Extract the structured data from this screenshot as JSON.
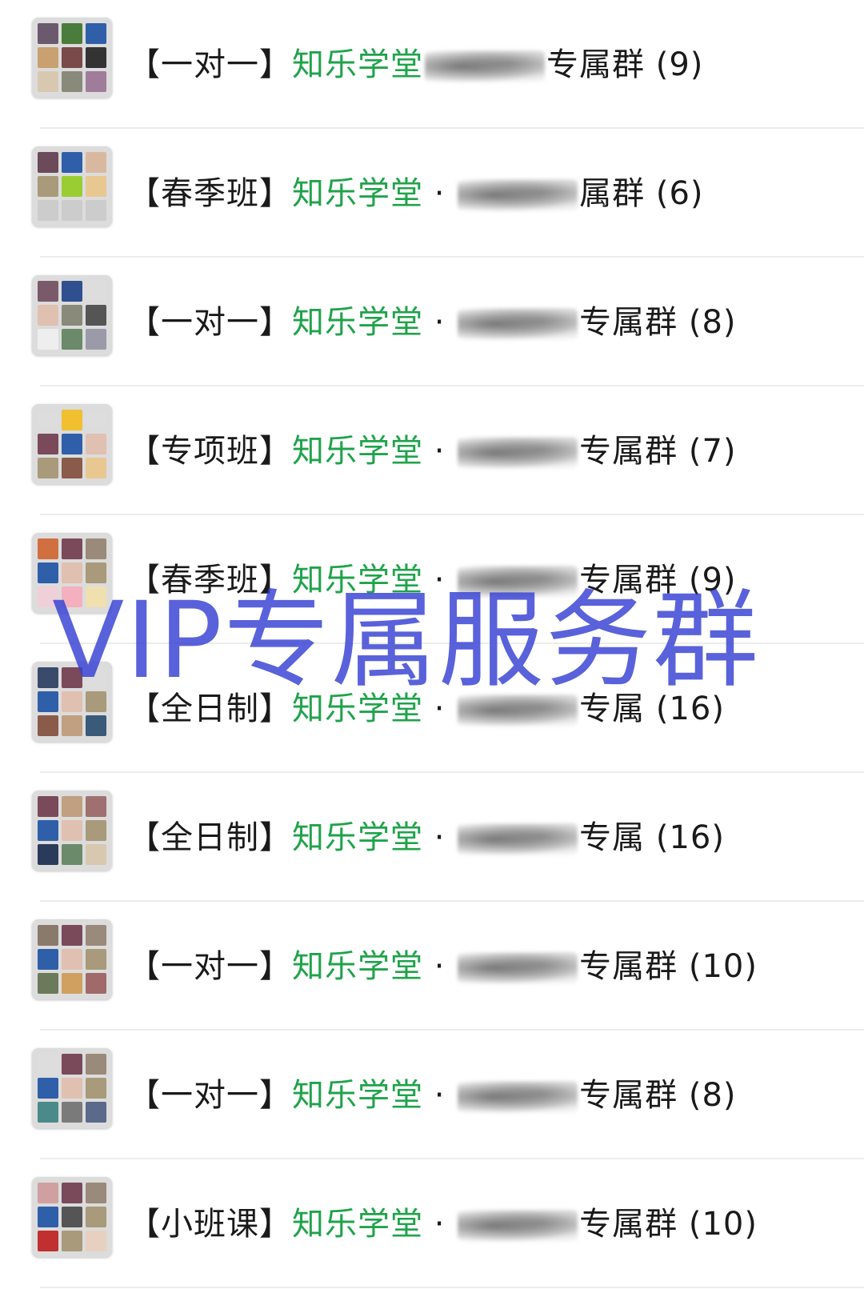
{
  "groups": [
    {
      "prefix": "【一对一】",
      "brand": "知乐学堂",
      "sep": "",
      "suffix": "专属群",
      "count": "(9)",
      "tiles": [
        "#6b5a6e",
        "#4a7c3b",
        "#2f5fa8",
        "#c9a070",
        "#7a4a4a",
        "#333333",
        "#d9c8b0",
        "#8a8a7a",
        "#a07c9a"
      ]
    },
    {
      "prefix": "【春季班】",
      "brand": "知乐学堂",
      "sep": " · ",
      "suffix": "属群",
      "count": "(6)",
      "tiles": [
        "#6b4a5a",
        "#2f5fa8",
        "#d9b8a0",
        "#a89a7a",
        "#9acd32",
        "#e8c890",
        "#cccccc",
        "#cccccc",
        "#cccccc"
      ]
    },
    {
      "prefix": "【一对一】",
      "brand": "知乐学堂",
      "sep": " · ",
      "suffix": "专属群",
      "count": "(8)",
      "tiles": [
        "#7a5a6a",
        "#2f4f8f",
        "#dddddd",
        "#e0c0b0",
        "#8a8a7a",
        "#555555",
        "#eeeeee",
        "#6a8a6a",
        "#9a9aa8"
      ]
    },
    {
      "prefix": "【专项班】",
      "brand": "知乐学堂",
      "sep": " · ",
      "suffix": "专属群",
      "count": "(7)",
      "tiles": [
        "#dddddd",
        "#f0c030",
        "#dddddd",
        "#7a4a5a",
        "#2f5fa8",
        "#e0c0b0",
        "#a89a7a",
        "#8a5a4a",
        "#e8c890"
      ]
    },
    {
      "prefix": "【春季班】",
      "brand": "知乐学堂",
      "sep": " · ",
      "suffix": "专属群",
      "count": "(9)",
      "tiles": [
        "#d07040",
        "#7a4a5a",
        "#9a8a7a",
        "#2f5fa8",
        "#e0c0b0",
        "#a89a7a",
        "#f0d0d8",
        "#f5b0c0",
        "#f0e0b0"
      ]
    },
    {
      "prefix": "【全日制】",
      "brand": "知乐学堂",
      "sep": " · ",
      "suffix": "专属",
      "count": "(16)",
      "tiles": [
        "#3a4a6a",
        "#7a4a5a",
        "#dddddd",
        "#2f5fa8",
        "#e0c0b0",
        "#a89a7a",
        "#8a5a4a",
        "#c0a080",
        "#3a5a7a"
      ]
    },
    {
      "prefix": "【全日制】",
      "brand": "知乐学堂",
      "sep": " · ",
      "suffix": "专属",
      "count": "(16)",
      "tiles": [
        "#7a4a5a",
        "#c0a080",
        "#a07070",
        "#2f5fa8",
        "#e0c0b0",
        "#a89a7a",
        "#2a3a5a",
        "#6a8a6a",
        "#d9c8b0"
      ]
    },
    {
      "prefix": "【一对一】",
      "brand": "知乐学堂",
      "sep": " · ",
      "suffix": "专属群",
      "count": "(10)",
      "tiles": [
        "#8a7a6a",
        "#7a4a5a",
        "#9a8a7a",
        "#2f5fa8",
        "#e0c0b0",
        "#a89a7a",
        "#6a7a5a",
        "#d0a060",
        "#a06a6a"
      ]
    },
    {
      "prefix": "【一对一】",
      "brand": "知乐学堂",
      "sep": " · ",
      "suffix": "专属群",
      "count": "(8)",
      "tiles": [
        "#dddddd",
        "#7a4a5a",
        "#9a8a7a",
        "#2f5fa8",
        "#e0c0b0",
        "#a89a7a",
        "#4a8a8a",
        "#7a7a7a",
        "#5a6a8a"
      ]
    },
    {
      "prefix": "【小班课】",
      "brand": "知乐学堂",
      "sep": " · ",
      "suffix": "专属群",
      "count": "(10)",
      "tiles": [
        "#d0a0a0",
        "#7a4a5a",
        "#9a8a7a",
        "#2f5fa8",
        "#555555",
        "#a89a7a",
        "#c03030",
        "#a89a7a",
        "#e8d0c0"
      ]
    }
  ],
  "watermark": "VIP专属服务群"
}
